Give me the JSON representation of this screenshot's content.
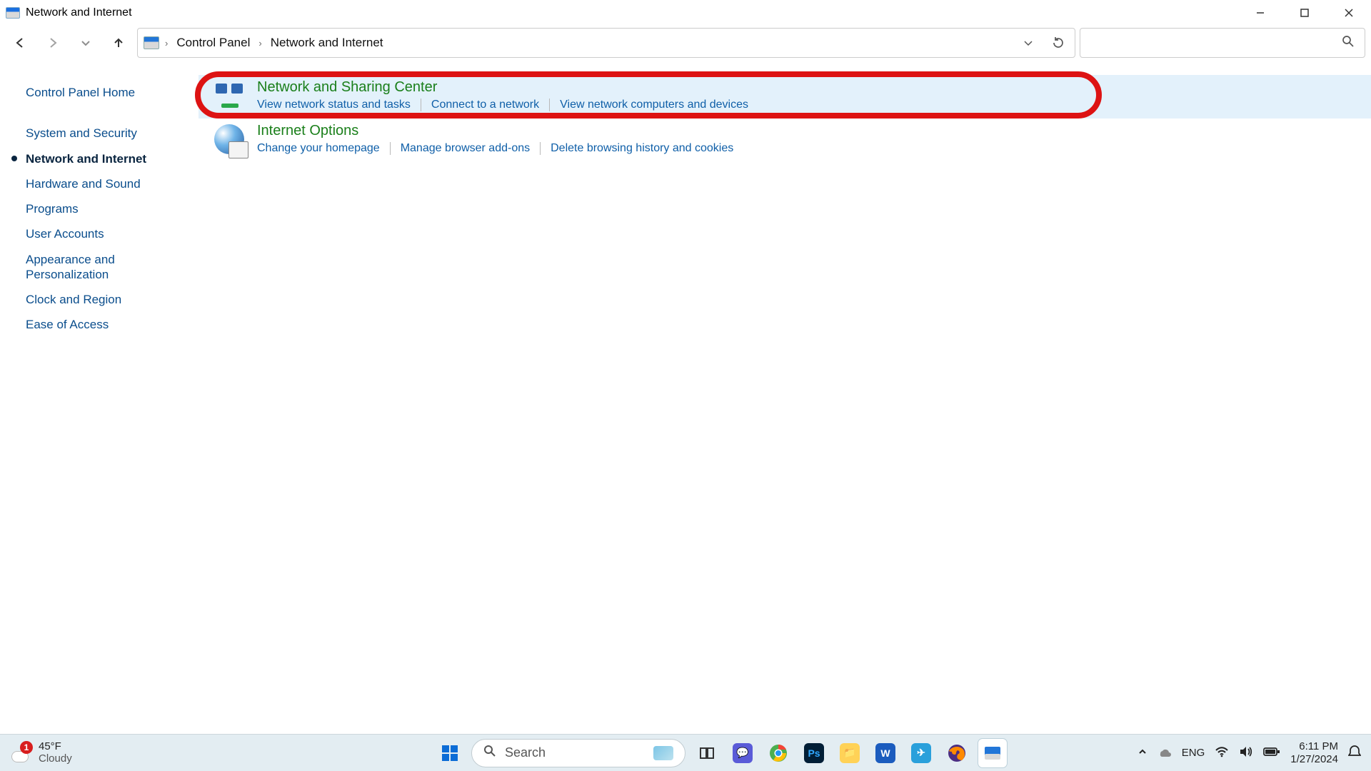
{
  "window": {
    "title": "Network and Internet"
  },
  "breadcrumbs": [
    "Control Panel",
    "Network and Internet"
  ],
  "sidebar": {
    "home": "Control Panel Home",
    "items": [
      "System and Security",
      "Network and Internet",
      "Hardware and Sound",
      "Programs",
      "User Accounts",
      "Appearance and Personalization",
      "Clock and Region",
      "Ease of Access"
    ],
    "current_index": 1
  },
  "categories": [
    {
      "title": "Network and Sharing Center",
      "links": [
        "View network status and tasks",
        "Connect to a network",
        "View network computers and devices"
      ],
      "highlighted": true
    },
    {
      "title": "Internet Options",
      "links": [
        "Change your homepage",
        "Manage browser add-ons",
        "Delete browsing history and cookies"
      ],
      "highlighted": false
    }
  ],
  "taskbar": {
    "weather": {
      "temp": "45°F",
      "cond": "Cloudy",
      "badge": "1"
    },
    "search_placeholder": "Search",
    "lang": "ENG",
    "time": "6:11 PM",
    "date": "1/27/2024"
  }
}
